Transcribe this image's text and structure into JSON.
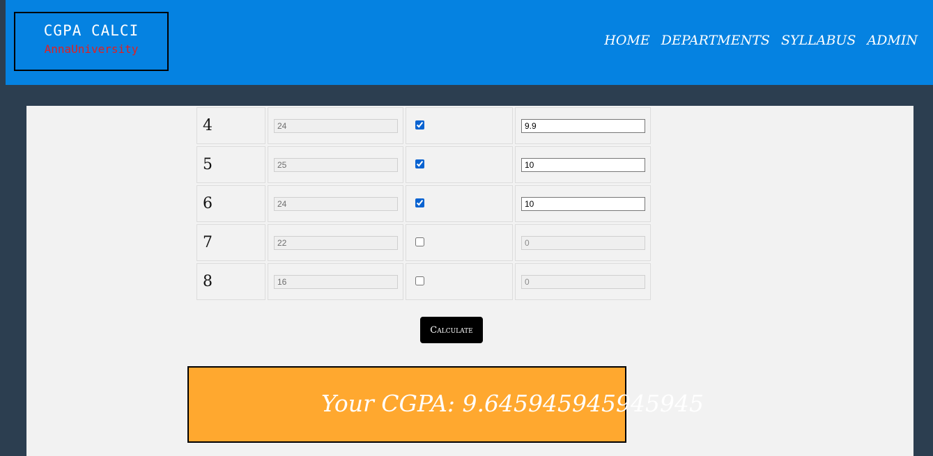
{
  "header": {
    "logo_title": "CGPA CALCI",
    "logo_subtitle": "AnnaUniversity",
    "nav": [
      "HOME",
      "DEPARTMENTS",
      "SYLLABUS",
      "ADMIN"
    ]
  },
  "semesters": [
    {
      "sem": "4",
      "credits": "24",
      "checked": true,
      "gpa": "9.9"
    },
    {
      "sem": "5",
      "credits": "25",
      "checked": true,
      "gpa": "10"
    },
    {
      "sem": "6",
      "credits": "24",
      "checked": true,
      "gpa": "10"
    },
    {
      "sem": "7",
      "credits": "22",
      "checked": false,
      "gpa": "0"
    },
    {
      "sem": "8",
      "credits": "16",
      "checked": false,
      "gpa": "0"
    }
  ],
  "calculate_label": "Calculate",
  "result": {
    "text": "Your CGPA: 9.645945945945945"
  },
  "colors": {
    "navbar": "#0582e1",
    "page_bg": "#2c3e50",
    "content_bg": "#f2f2f2",
    "result_bg": "#ffa82f",
    "logo_subtitle": "#e41f1f"
  }
}
